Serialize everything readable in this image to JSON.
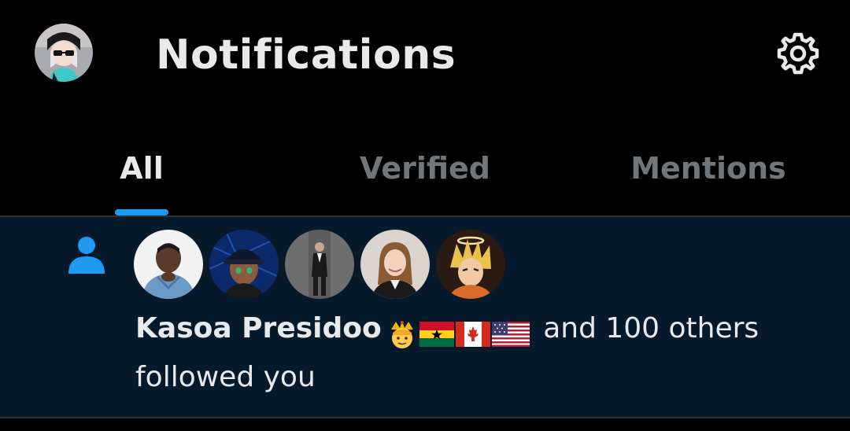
{
  "header": {
    "title": "Notifications",
    "avatar_icon": "user-avatar-icon",
    "settings_icon": "gear-icon"
  },
  "tabs": [
    {
      "label": "All",
      "active": true
    },
    {
      "label": "Verified",
      "active": false
    },
    {
      "label": "Mentions",
      "active": false
    }
  ],
  "notification": {
    "type_icon": "person-follow-icon",
    "actor": "Kasoa Presidoo",
    "emojis": [
      "prince-emoji",
      "flag-ghana",
      "flag-canada",
      "flag-usa"
    ],
    "rest_line1": "and 100 others",
    "rest_line2": "followed you",
    "avatars": [
      "follower-avatar-1",
      "follower-avatar-2",
      "follower-avatar-3",
      "follower-avatar-4",
      "follower-avatar-5"
    ]
  },
  "colors": {
    "background": "#000000",
    "notification_bg": "#071a2b",
    "accent": "#1d9bf0",
    "text_primary": "#e7e9ea",
    "text_secondary": "#71767b"
  }
}
